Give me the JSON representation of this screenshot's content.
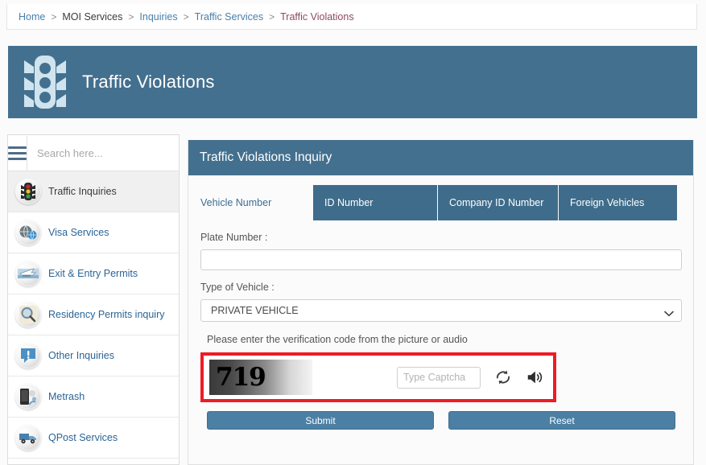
{
  "breadcrumb": {
    "items": [
      {
        "label": "Home",
        "style": "link"
      },
      {
        "label": "MOI Services",
        "style": "plain"
      },
      {
        "label": "Inquiries",
        "style": "link"
      },
      {
        "label": "Traffic Services",
        "style": "link"
      },
      {
        "label": "Traffic Violations",
        "style": "current"
      }
    ],
    "separator": ">"
  },
  "banner": {
    "title": "Traffic Violations",
    "icon": "traffic-light-icon",
    "background_color": "#44708f"
  },
  "sidebar": {
    "search": {
      "placeholder": "Search here...",
      "value": ""
    },
    "menu_icon": "hamburger-icon",
    "items": [
      {
        "label": "Traffic Inquiries",
        "icon": "traffic-light-icon",
        "active": true
      },
      {
        "label": "Visa Services",
        "icon": "globe-passport-icon",
        "active": false
      },
      {
        "label": "Exit & Entry Permits",
        "icon": "airplane-icon",
        "active": false
      },
      {
        "label": "Residency Permits inquiry",
        "icon": "magnifier-icon",
        "active": false
      },
      {
        "label": "Other Inquiries",
        "icon": "exclamation-icon",
        "active": false
      },
      {
        "label": "Metrash",
        "icon": "mobile-device-icon",
        "active": false
      },
      {
        "label": "QPost Services",
        "icon": "delivery-van-icon",
        "active": false
      }
    ]
  },
  "main": {
    "panel_title": "Traffic Violations Inquiry",
    "tabs": [
      {
        "label": "Vehicle Number",
        "active": true
      },
      {
        "label": "ID Number",
        "active": false
      },
      {
        "label": "Company ID Number",
        "active": false
      },
      {
        "label": "Foreign Vehicles",
        "active": false
      }
    ],
    "plate_number": {
      "label": "Plate Number :",
      "value": "",
      "placeholder": ""
    },
    "vehicle_type": {
      "label": "Type of Vehicle :",
      "selected": "PRIVATE VEHICLE",
      "chevron_icon": "chevron-down-icon"
    },
    "captcha": {
      "note": "Please enter the verification code from the picture or audio",
      "code_image_text": "719",
      "input_placeholder": "Type Captcha",
      "input_value": "",
      "refresh_icon": "refresh-icon",
      "audio_icon": "speaker-icon",
      "highlight_color": "#ee1c24"
    },
    "buttons": {
      "submit_label": "Submit",
      "reset_label": "Reset",
      "color": "#4b7fa3"
    }
  }
}
